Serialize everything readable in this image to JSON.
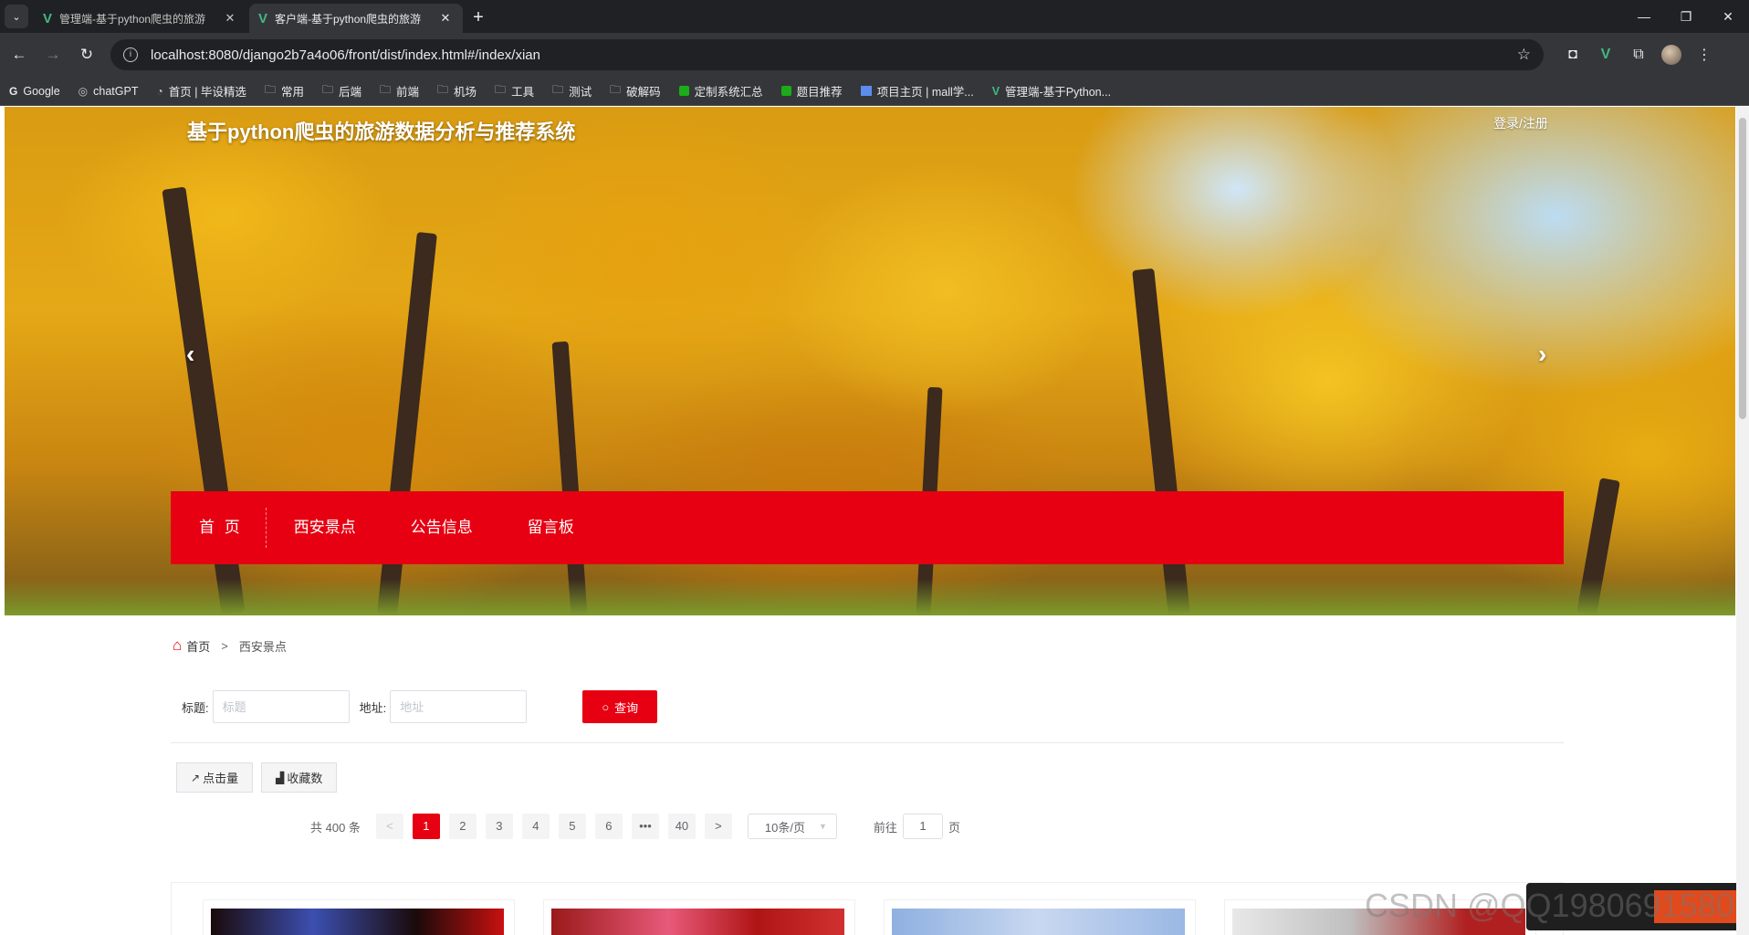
{
  "browser": {
    "tabs": [
      {
        "title": "管理端-基于python爬虫的旅游",
        "active": false
      },
      {
        "title": "客户端-基于python爬虫的旅游",
        "active": true
      }
    ],
    "url": "localhost:8080/django2b7a4o06/front/dist/index.html#/index/xian",
    "bookmarks": [
      {
        "label": "Google",
        "icon": "google-icon"
      },
      {
        "label": "chatGPT",
        "icon": "chatgpt-icon"
      },
      {
        "label": "首页 | 毕设精选",
        "icon": "site-icon"
      },
      {
        "label": "常用",
        "icon": "folder-icon"
      },
      {
        "label": "后端",
        "icon": "folder-icon"
      },
      {
        "label": "前端",
        "icon": "folder-icon"
      },
      {
        "label": "机场",
        "icon": "folder-icon"
      },
      {
        "label": "工具",
        "icon": "folder-icon"
      },
      {
        "label": "测试",
        "icon": "folder-icon"
      },
      {
        "label": "破解码",
        "icon": "folder-icon"
      },
      {
        "label": "定制系统汇总",
        "icon": "sheet-icon"
      },
      {
        "label": "题目推荐",
        "icon": "sheet-icon"
      },
      {
        "label": "项目主页 | mall学...",
        "icon": "page-icon"
      },
      {
        "label": "管理端-基于Python...",
        "icon": "vue-icon"
      }
    ]
  },
  "site": {
    "title": "基于python爬虫的旅游数据分析与推荐系统",
    "login": "登录/注册",
    "nav": [
      "首 页",
      "西安景点",
      "公告信息",
      "留言板"
    ]
  },
  "breadcrumb": {
    "home": "首页",
    "separator": ">",
    "current": "西安景点"
  },
  "search": {
    "title_label": "标题:",
    "title_placeholder": "标题",
    "address_label": "地址:",
    "address_placeholder": "地址",
    "button": "查询"
  },
  "sort": {
    "clicks": "点击量",
    "favorites": "收藏数"
  },
  "pagination": {
    "total": "共 400 条",
    "prev": "<",
    "next": ">",
    "pages": [
      "1",
      "2",
      "3",
      "4",
      "5",
      "6",
      "•••",
      "40"
    ],
    "current": "1",
    "page_size": "10条/页",
    "goto_label": "前往",
    "goto_value": "1",
    "goto_unit": "页"
  },
  "watermark": "CSDN @QQ1980691580",
  "colors": {
    "primary": "#e60012",
    "chrome_dark": "#202124",
    "chrome": "#35363a"
  }
}
